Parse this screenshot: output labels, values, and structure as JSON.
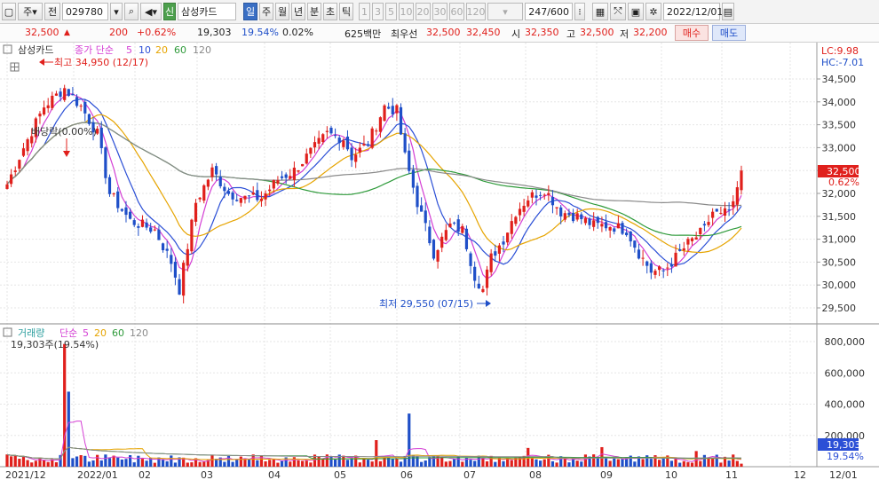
{
  "toolbar": {
    "market": "주",
    "period_mode": "전",
    "code": "029780",
    "badge": "신",
    "name": "삼성카드",
    "periods": [
      "일",
      "주",
      "월",
      "년",
      "분",
      "초",
      "틱"
    ],
    "minutes": [
      "1",
      "3",
      "5",
      "10",
      "20",
      "30",
      "60",
      "120"
    ],
    "count": "247/600",
    "date": "2022/12/01"
  },
  "quote": {
    "price": "32,500",
    "change": "200",
    "change_pct": "+0.62%",
    "volume": "19,303",
    "vol_ratio": "19.54%",
    "turnover": "0.02%",
    "amount": "625백만",
    "priority_label": "최우선",
    "ask": "32,500",
    "bid": "32,450",
    "open_label": "시",
    "open": "32,350",
    "high_label": "고",
    "high": "32,500",
    "low_label": "저",
    "low": "32,200",
    "buy": "매수",
    "sell": "매도"
  },
  "price_panel": {
    "stock": "삼성카드",
    "ma_label": "종가 단순",
    "ma_periods": [
      "5",
      "10",
      "20",
      "60",
      "120"
    ],
    "lc": "LC:9.98",
    "hc": "HC:-7.01",
    "high_note": "최고 34,950 (12/17)",
    "dividend_note": "배당락(0.00%)",
    "low_note": "최저 29,550 (07/15)",
    "last_price_tag": "32,500",
    "last_pct_tag": "0.62%"
  },
  "volume_panel": {
    "title": "거래량",
    "ma_label": "단순",
    "ma_periods": [
      "5",
      "20",
      "60",
      "120"
    ],
    "volume_note": "19,303주(19.54%)",
    "last_volume_tag": "19,303",
    "last_pct_tag": "19.54%"
  },
  "chart_data": {
    "type": "candlestick",
    "y_ticks": [
      "34,500",
      "34,000",
      "33,500",
      "33,000",
      "32,500",
      "32,000",
      "31,500",
      "31,000",
      "30,500",
      "30,000",
      "29,500"
    ],
    "ylim": [
      29300,
      34950
    ],
    "vol_ticks": [
      "800,000",
      "600,000",
      "400,000",
      "200,000"
    ],
    "vol_ylim": [
      0,
      840000
    ],
    "x_ticks": [
      "2021/12",
      "2022/01",
      "02",
      "03",
      "04",
      "05",
      "06",
      "07",
      "08",
      "09",
      "10",
      "11",
      "12"
    ],
    "x_tick_right": "12/01",
    "price_path": [
      [
        0,
        32200
      ],
      [
        4,
        33000
      ],
      [
        9,
        33900
      ],
      [
        14,
        34300
      ],
      [
        18,
        33900
      ],
      [
        22,
        33300
      ],
      [
        25,
        32000
      ],
      [
        30,
        31400
      ],
      [
        36,
        31200
      ],
      [
        40,
        30500
      ],
      [
        42,
        29900
      ],
      [
        46,
        31800
      ],
      [
        50,
        32500
      ],
      [
        54,
        32000
      ],
      [
        58,
        31900
      ],
      [
        62,
        31900
      ],
      [
        66,
        32300
      ],
      [
        70,
        32500
      ],
      [
        74,
        32900
      ],
      [
        78,
        33300
      ],
      [
        82,
        33200
      ],
      [
        84,
        32800
      ],
      [
        88,
        33100
      ],
      [
        92,
        33900
      ],
      [
        95,
        33800
      ],
      [
        97,
        32800
      ],
      [
        100,
        31800
      ],
      [
        104,
        30700
      ],
      [
        108,
        31300
      ],
      [
        111,
        31200
      ],
      [
        114,
        30200
      ],
      [
        116,
        29900
      ],
      [
        118,
        30600
      ],
      [
        121,
        31000
      ],
      [
        124,
        31600
      ],
      [
        127,
        31900
      ],
      [
        131,
        32100
      ],
      [
        135,
        31600
      ],
      [
        139,
        31500
      ],
      [
        143,
        31300
      ],
      [
        147,
        31300
      ],
      [
        151,
        31200
      ],
      [
        154,
        30700
      ],
      [
        157,
        30300
      ],
      [
        160,
        30300
      ],
      [
        163,
        30600
      ],
      [
        166,
        30900
      ],
      [
        170,
        31200
      ],
      [
        172,
        31600
      ],
      [
        174,
        31500
      ],
      [
        177,
        31700
      ],
      [
        179,
        32500
      ]
    ],
    "vol_spikes": {
      "14": 785000,
      "15": 480000,
      "90": 170000,
      "98": 340000,
      "127": 120000,
      "145": 125000,
      "168": 100000
    }
  }
}
